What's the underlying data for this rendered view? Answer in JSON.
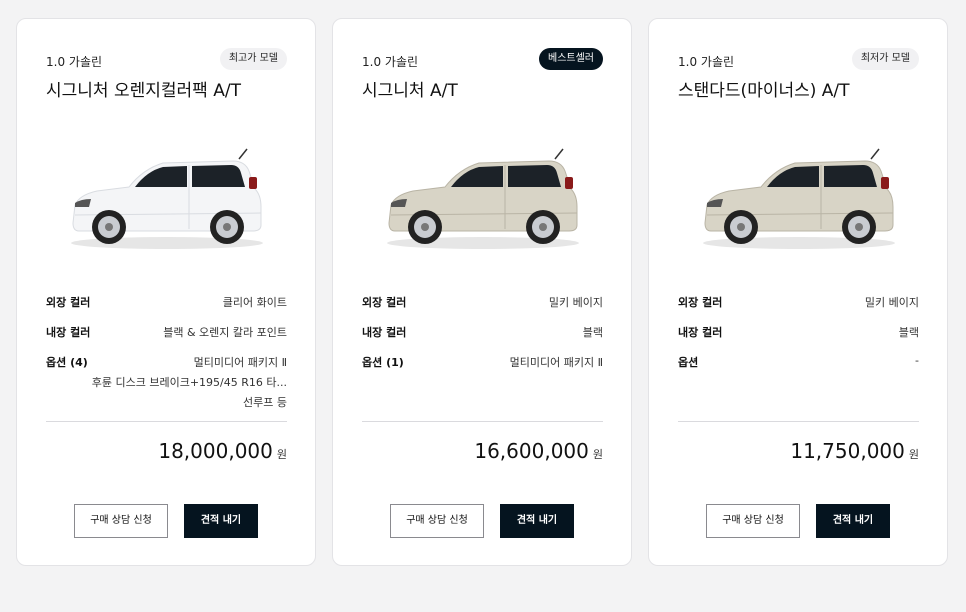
{
  "colors": {
    "accent_dark": "#05141f",
    "car_white": "#f4f5f7",
    "car_beige": "#d8d4c6"
  },
  "cards": [
    {
      "fuel": "1.0 가솔린",
      "badge": "최고가 모델",
      "badge_style": "light",
      "title": "시그니처 오렌지컬러팩 A/T",
      "car_icon": "car-side-icon",
      "car_color": "white",
      "specs": {
        "exterior_label": "외장 컬러",
        "exterior_value": "클리어 화이트",
        "interior_label": "내장 컬러",
        "interior_value": "블랙 & 오렌지 칼라 포인트",
        "options_label": "옵션 (4)",
        "options_lines": [
          "멀티미디어 패키지 Ⅱ",
          "후륜 디스크 브레이크+195/45 R16 타...",
          "선루프 등"
        ]
      },
      "price": "18,000,000",
      "price_unit": "원",
      "consult_label": "구매 상담 신청",
      "estimate_label": "견적 내기"
    },
    {
      "fuel": "1.0 가솔린",
      "badge": "베스트셀러",
      "badge_style": "dark",
      "title": "시그니처 A/T",
      "car_icon": "car-side-icon",
      "car_color": "beige",
      "specs": {
        "exterior_label": "외장 컬러",
        "exterior_value": "밀키 베이지",
        "interior_label": "내장 컬러",
        "interior_value": "블랙",
        "options_label": "옵션 (1)",
        "options_lines": [
          "멀티미디어 패키지 Ⅱ"
        ]
      },
      "price": "16,600,000",
      "price_unit": "원",
      "consult_label": "구매 상담 신청",
      "estimate_label": "견적 내기"
    },
    {
      "fuel": "1.0 가솔린",
      "badge": "최저가 모델",
      "badge_style": "light",
      "title": "스탠다드(마이너스) A/T",
      "car_icon": "car-side-icon",
      "car_color": "beige",
      "specs": {
        "exterior_label": "외장 컬러",
        "exterior_value": "밀키 베이지",
        "interior_label": "내장 컬러",
        "interior_value": "블랙",
        "options_label": "옵션",
        "options_lines": [
          "-"
        ]
      },
      "price": "11,750,000",
      "price_unit": "원",
      "consult_label": "구매 상담 신청",
      "estimate_label": "견적 내기"
    }
  ]
}
